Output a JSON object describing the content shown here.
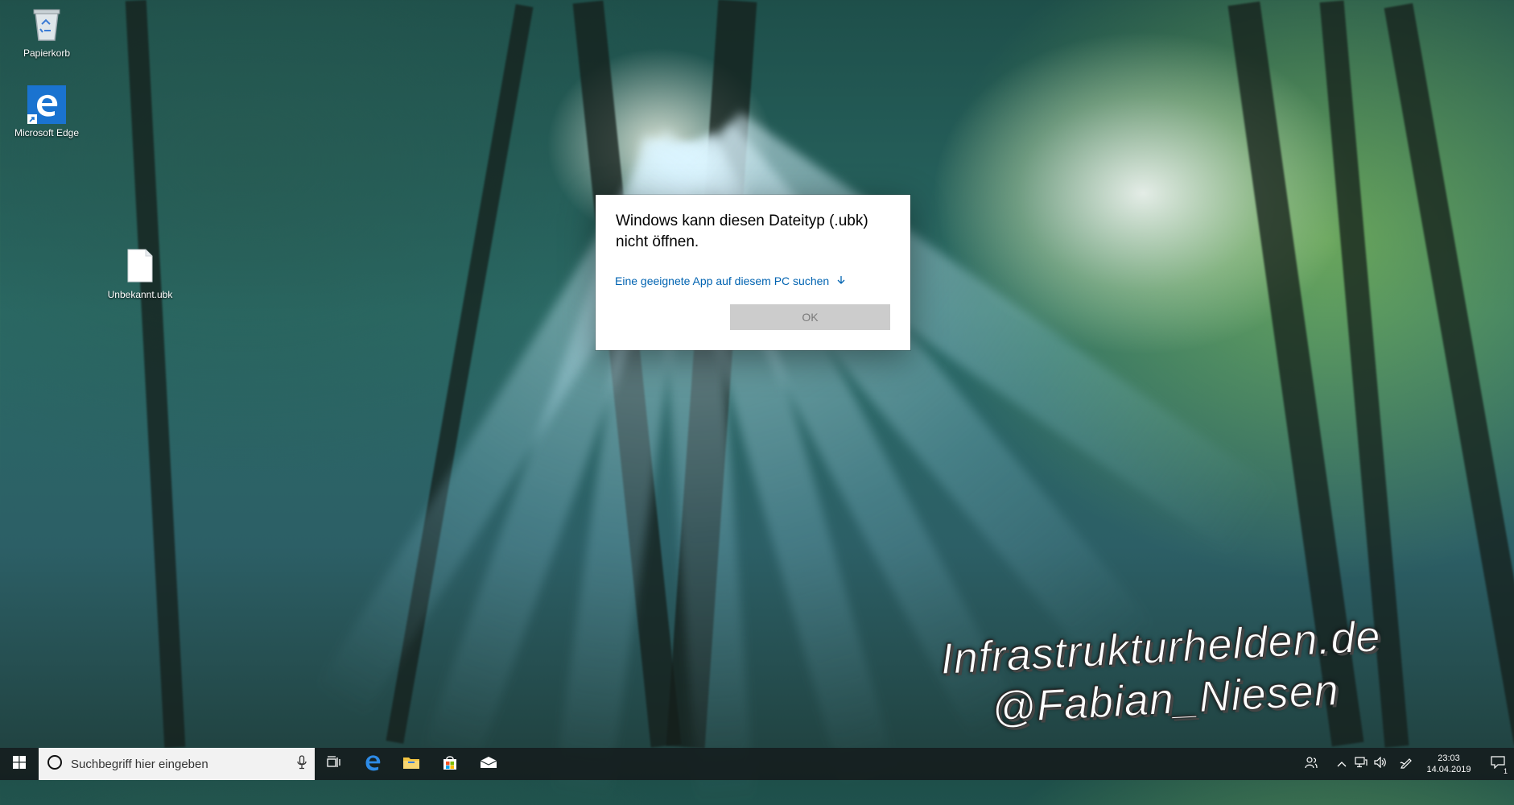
{
  "desktop": {
    "icons": [
      {
        "label": "Papierkorb",
        "icon": "recycle-bin-icon"
      },
      {
        "label": "Microsoft Edge",
        "icon": "edge-icon"
      },
      {
        "label": "Unbekannt.ubk",
        "icon": "file-icon"
      }
    ]
  },
  "dialog": {
    "message": "Windows kann diesen Dateityp (.ubk) nicht öffnen.",
    "link_label": "Eine geeignete App auf diesem PC suchen",
    "ok_label": "OK"
  },
  "watermark": {
    "line1": "Infrastrukturhelden.de",
    "line2": "@Fabian_Niesen"
  },
  "taskbar": {
    "search_placeholder": "Suchbegriff hier eingeben",
    "pinned": [
      "task-view-icon",
      "edge-icon",
      "file-explorer-icon",
      "store-icon",
      "mail-icon"
    ],
    "clock": {
      "time": "23:03",
      "date": "14.04.2019"
    },
    "notification_count": "1"
  },
  "colors": {
    "link": "#0063b1",
    "taskbar": "#141c1e",
    "ok_button": "#cccccc"
  }
}
